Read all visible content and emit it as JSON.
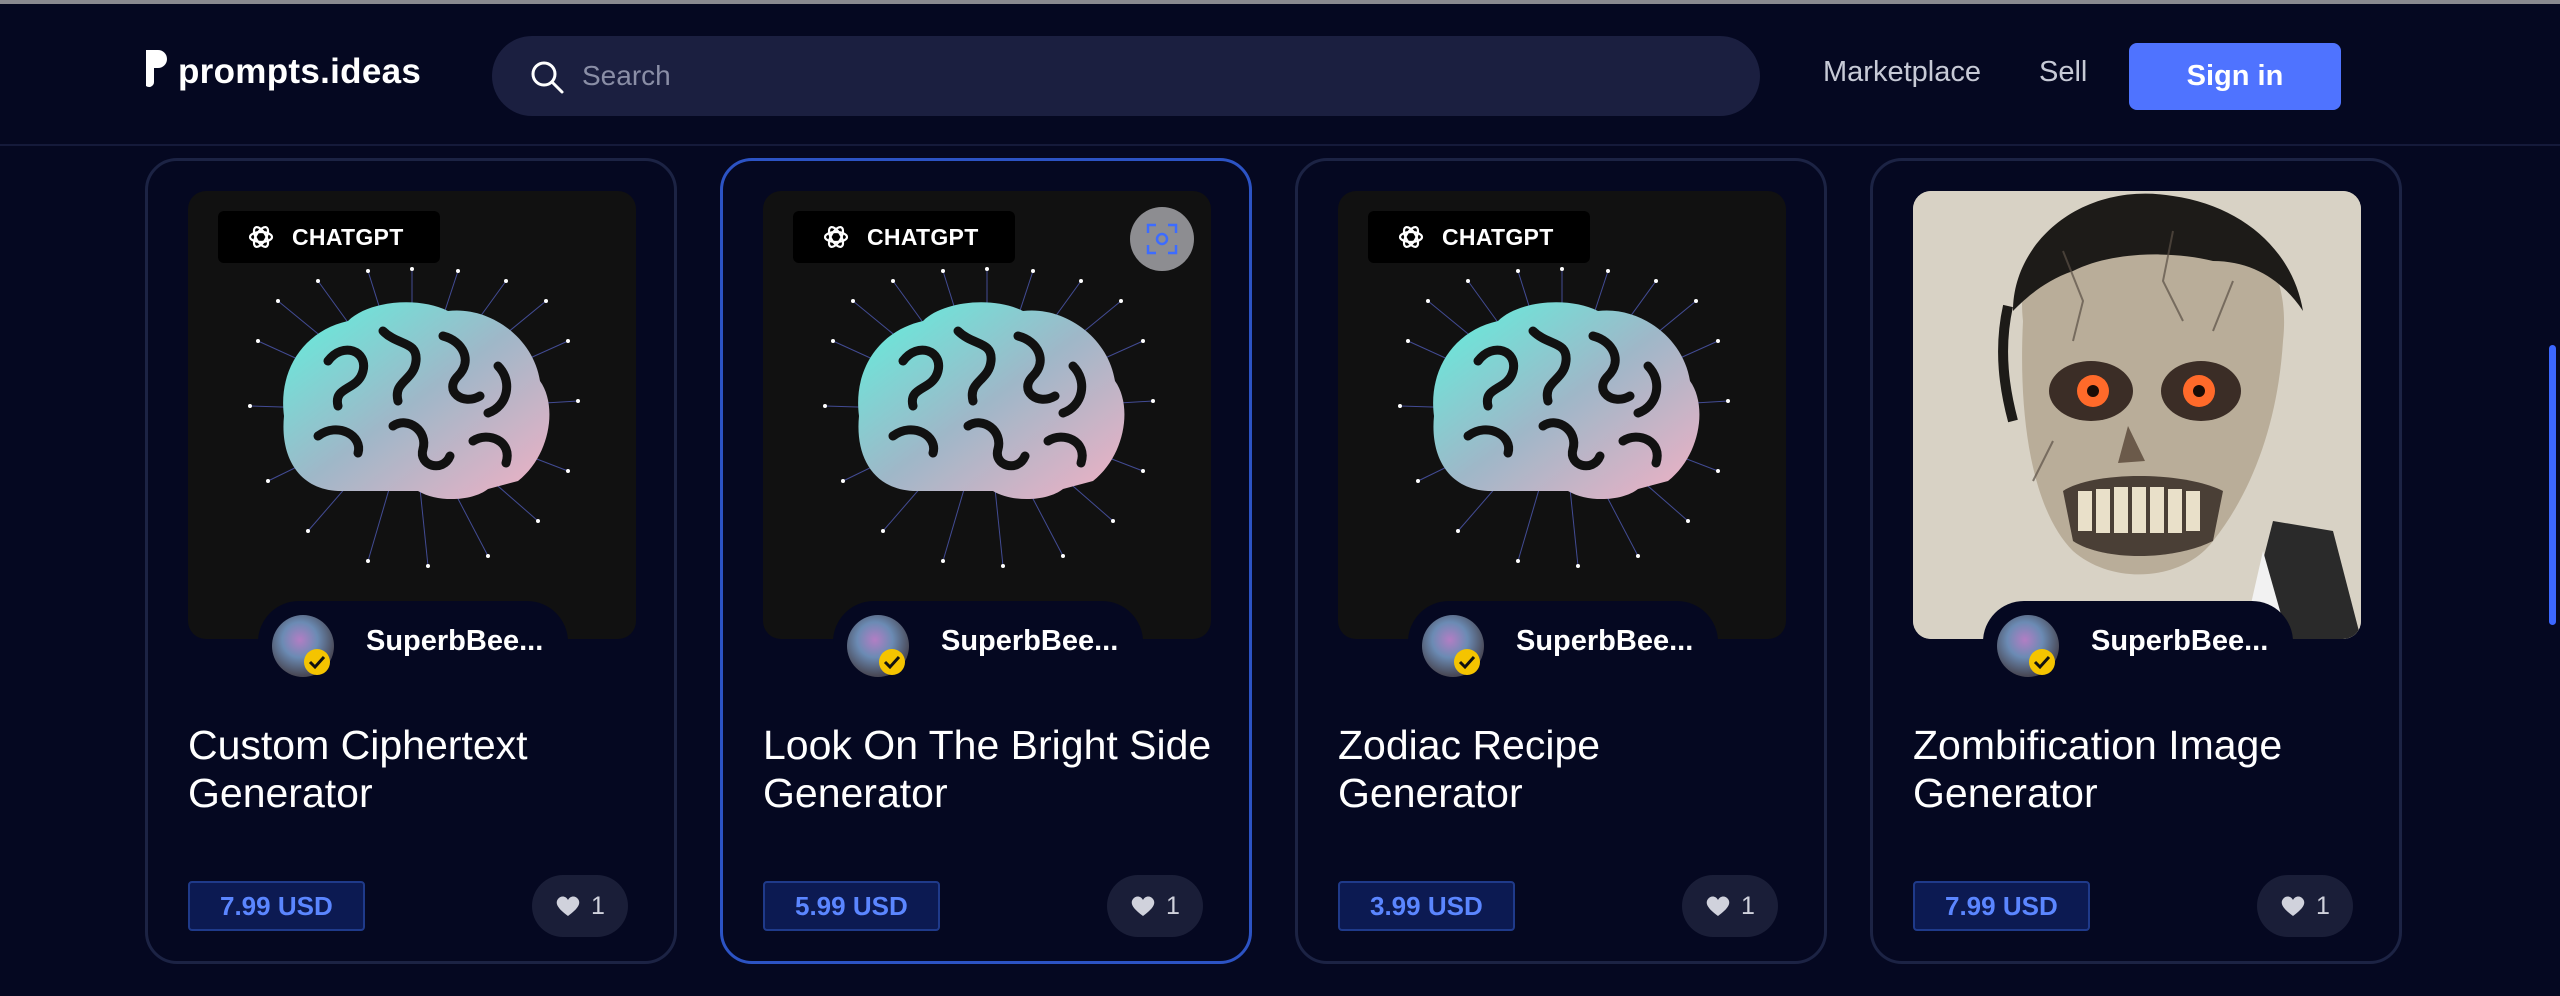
{
  "header": {
    "logo_text": "prompts.ideas",
    "search_placeholder": "Search",
    "nav": [
      "Marketplace",
      "Sell"
    ],
    "signin_label": "Sign in"
  },
  "colors": {
    "background": "#050821",
    "accent": "#4f73ff",
    "price_text": "#5b86ff"
  },
  "cards": [
    {
      "badge": "CHATGPT",
      "author": "SuperbBee...",
      "title": "Custom Ciphertext Generator",
      "price": "7.99 USD",
      "likes": "1",
      "image": "brain"
    },
    {
      "badge": "CHATGPT",
      "author": "SuperbBee...",
      "title": "Look On The Bright Side Generator",
      "price": "5.99 USD",
      "likes": "1",
      "image": "brain"
    },
    {
      "badge": "CHATGPT",
      "author": "SuperbBee...",
      "title": "Zodiac Recipe Generator",
      "price": "3.99 USD",
      "likes": "1",
      "image": "brain"
    },
    {
      "badge": "",
      "author": "SuperbBee...",
      "title": "Zombification Image Generator",
      "price": "7.99 USD",
      "likes": "1",
      "image": "zombie"
    }
  ]
}
